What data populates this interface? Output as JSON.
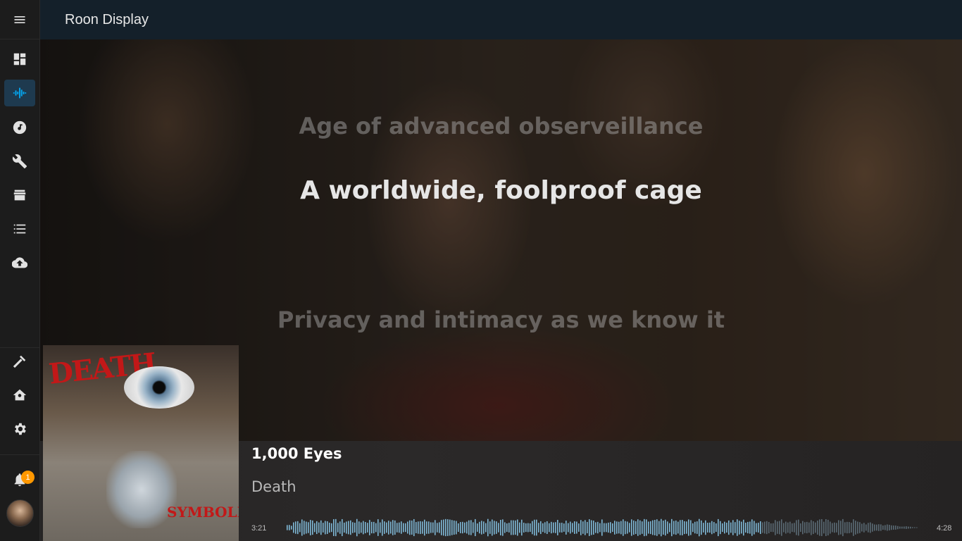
{
  "app": {
    "title": "Roon Display"
  },
  "sidebar": {
    "menu_icon": "hamburger-menu-icon",
    "items": [
      {
        "name": "overview",
        "icon": "dashboard-icon",
        "active": false
      },
      {
        "name": "roon-display",
        "icon": "waveform-icon",
        "active": true
      },
      {
        "name": "media",
        "icon": "music-note-icon",
        "active": false
      },
      {
        "name": "config",
        "icon": "wrench-icon",
        "active": false
      },
      {
        "name": "hacs",
        "icon": "store-icon",
        "active": false
      },
      {
        "name": "logbook",
        "icon": "list-icon",
        "active": false
      },
      {
        "name": "backup",
        "icon": "cloud-upload-icon",
        "active": false
      }
    ],
    "bottom_items": [
      {
        "name": "developer-tools",
        "icon": "hammer-icon"
      },
      {
        "name": "settings-home",
        "icon": "home-gear-icon"
      },
      {
        "name": "settings",
        "icon": "gear-icon"
      }
    ],
    "notifications": {
      "count": "1",
      "icon": "bell-icon"
    },
    "accent_color": "#03a9f4"
  },
  "lyrics": {
    "previous": "Age of advanced observeillance",
    "current": "A worldwide, foolproof cage",
    "next": "Privacy and intimacy as we know it"
  },
  "now_playing": {
    "title": "1,000 Eyes",
    "artist": "Death",
    "elapsed": "3:21",
    "duration": "4:28",
    "progress": 0.75,
    "album_art": {
      "logo_text": "DEATH",
      "album_text": "SYMBOLIC"
    }
  }
}
